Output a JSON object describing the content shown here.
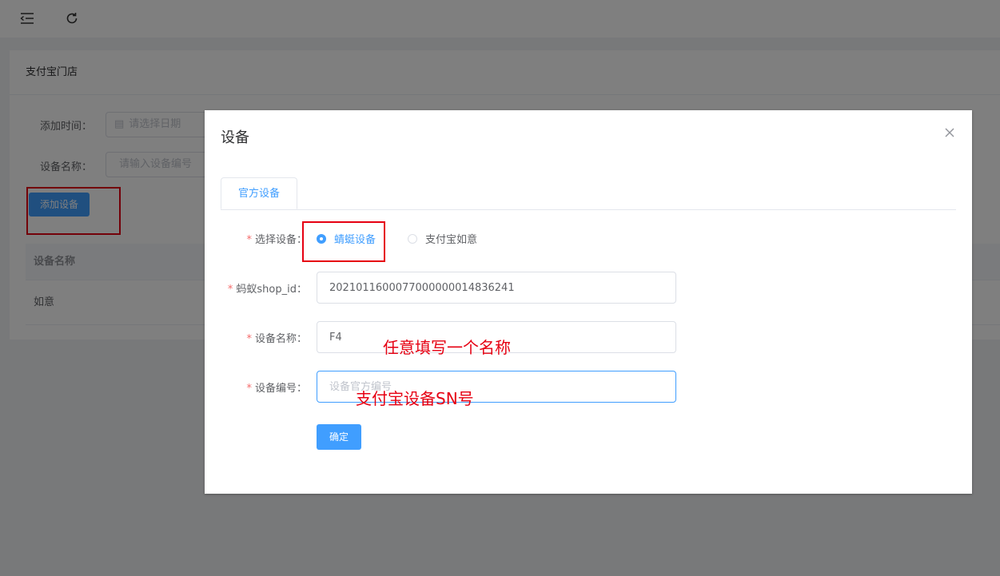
{
  "topbar": {
    "menu_icon": "menu-fold-icon",
    "refresh_icon": "refresh-icon"
  },
  "page": {
    "card_title": "支付宝门店",
    "filters": {
      "time_label": "添加时间：",
      "time_placeholder": "请选择日期",
      "name_label": "设备名称：",
      "name_placeholder": "请输入设备编号"
    },
    "add_button": "添加设备",
    "table": {
      "header": "设备名称",
      "rows": [
        "如意"
      ]
    }
  },
  "dialog": {
    "title": "设备",
    "tab": "官方设备",
    "form": {
      "select_label": "选择设备：",
      "radio_options": [
        "蜻蜓设备",
        "支付宝如意"
      ],
      "selected": "蜻蜓设备",
      "shop_id_label": "蚂蚁shop_id：",
      "shop_id_value": "2021011600077000000014836241",
      "device_name_label": "设备名称：",
      "device_name_value": "F4",
      "device_no_label": "设备编号：",
      "device_no_placeholder": "设备官方编号",
      "submit": "确定"
    }
  },
  "annotations": {
    "name_hint": "任意填写一个名称",
    "sn_hint": "支付宝设备SN号"
  },
  "colors": {
    "primary": "#409eff",
    "annotation": "#e60012",
    "required": "#f56c6c"
  }
}
